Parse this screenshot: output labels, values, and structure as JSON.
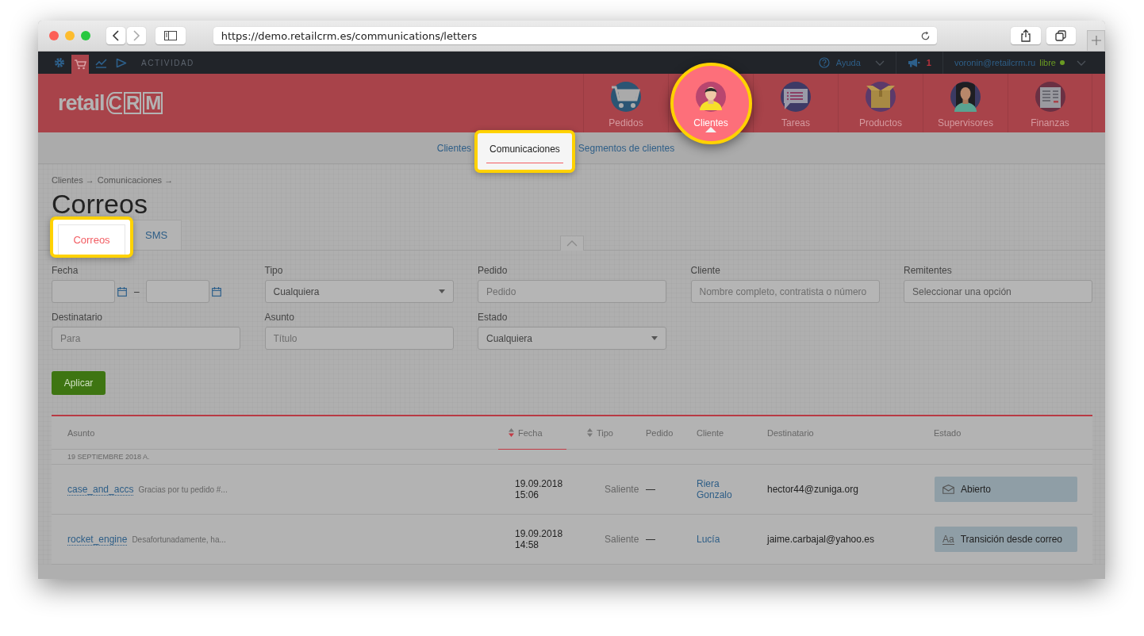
{
  "browser": {
    "url": "https://demo.retailcrm.es/communications/letters"
  },
  "topbar": {
    "apps": [
      {
        "selected": false
      },
      {
        "selected": true
      },
      {
        "selected": false
      },
      {
        "selected": false
      }
    ],
    "section": "ACTIVIDAD",
    "help": "Ayuda",
    "notifications": "1",
    "user": "voronin@retailcrm.ru",
    "status": "libre"
  },
  "logo": {
    "text": "retail",
    "letters": [
      "C",
      "R",
      "M"
    ]
  },
  "modules": [
    {
      "label": "Pedidos",
      "selected": false,
      "highlighted": false
    },
    {
      "label": "Clientes",
      "selected": true,
      "highlighted": true
    },
    {
      "label": "Tareas",
      "selected": false,
      "highlighted": false
    },
    {
      "label": "Productos",
      "selected": false,
      "highlighted": false
    },
    {
      "label": "Supervisores",
      "selected": false,
      "highlighted": false
    },
    {
      "label": "Finanzas",
      "selected": false,
      "highlighted": false
    }
  ],
  "subnav": [
    {
      "label": "Clientes",
      "selected": false,
      "highlighted": false
    },
    {
      "label": "Comunicaciones",
      "selected": true,
      "highlighted": true
    },
    {
      "label": "Segmentos de clientes",
      "selected": false,
      "highlighted": false
    }
  ],
  "breadcrumb": [
    "Clientes →",
    "Comunicaciones →"
  ],
  "title": "Correos",
  "tabs": [
    {
      "label": "Correos",
      "selected": true,
      "highlighted": true
    },
    {
      "label": "SMS",
      "selected": false,
      "highlighted": false
    }
  ],
  "filters": [
    {
      "label": "Fecha",
      "kind": "date_range",
      "separator": "–"
    },
    {
      "label": "Tipo",
      "kind": "select",
      "value": "Cualquiera"
    },
    {
      "label": "Pedido",
      "kind": "text",
      "placeholder": "Pedido"
    },
    {
      "label": "Cliente",
      "kind": "text",
      "placeholder": "Nombre completo, contratista o número"
    },
    {
      "label": "Remitentes",
      "kind": "choice",
      "placeholder": "Seleccionar una opción"
    },
    {
      "label": "Destinatario",
      "kind": "text",
      "placeholder": "Para"
    },
    {
      "label": "Asunto",
      "kind": "text",
      "placeholder": "Título"
    },
    {
      "label": "Estado",
      "kind": "select",
      "value": "Cualquiera"
    }
  ],
  "apply_button": "Aplicar",
  "table": {
    "columns": [
      {
        "label": "Asunto",
        "sortable": false,
        "sorted": false
      },
      {
        "label": "Fecha",
        "sortable": true,
        "sorted": true
      },
      {
        "label": "Tipo",
        "sortable": true,
        "sorted": false
      },
      {
        "label": "Pedido",
        "sortable": false,
        "sorted": false
      },
      {
        "label": "Cliente",
        "sortable": false,
        "sorted": false
      },
      {
        "label": "Destinatario",
        "sortable": false,
        "sorted": false
      },
      {
        "label": "Estado",
        "sortable": false,
        "sorted": false
      }
    ],
    "group": "19 SEPTIEMBRE 2018 A.",
    "rows": [
      {
        "template": "case_and_accs",
        "preview": "Gracias por tu pedido #...",
        "date": "19.09.2018",
        "time": "15:06",
        "type": "Saliente",
        "order": "—",
        "client": "Riera Gonzalo",
        "recipient": "hector44@zuniga.org",
        "status": {
          "kind": "opened",
          "label": "Abierto"
        }
      },
      {
        "template": "rocket_engine",
        "preview": "Desafortunadamente, ha...",
        "date": "19.09.2018",
        "time": "14:58",
        "type": "Saliente",
        "order": "—",
        "client": "Lucía",
        "recipient": "jaime.carbajal@yahoo.es",
        "status": {
          "kind": "transition",
          "icon_text": "Aa",
          "label": "Transición desde correo"
        }
      }
    ]
  }
}
